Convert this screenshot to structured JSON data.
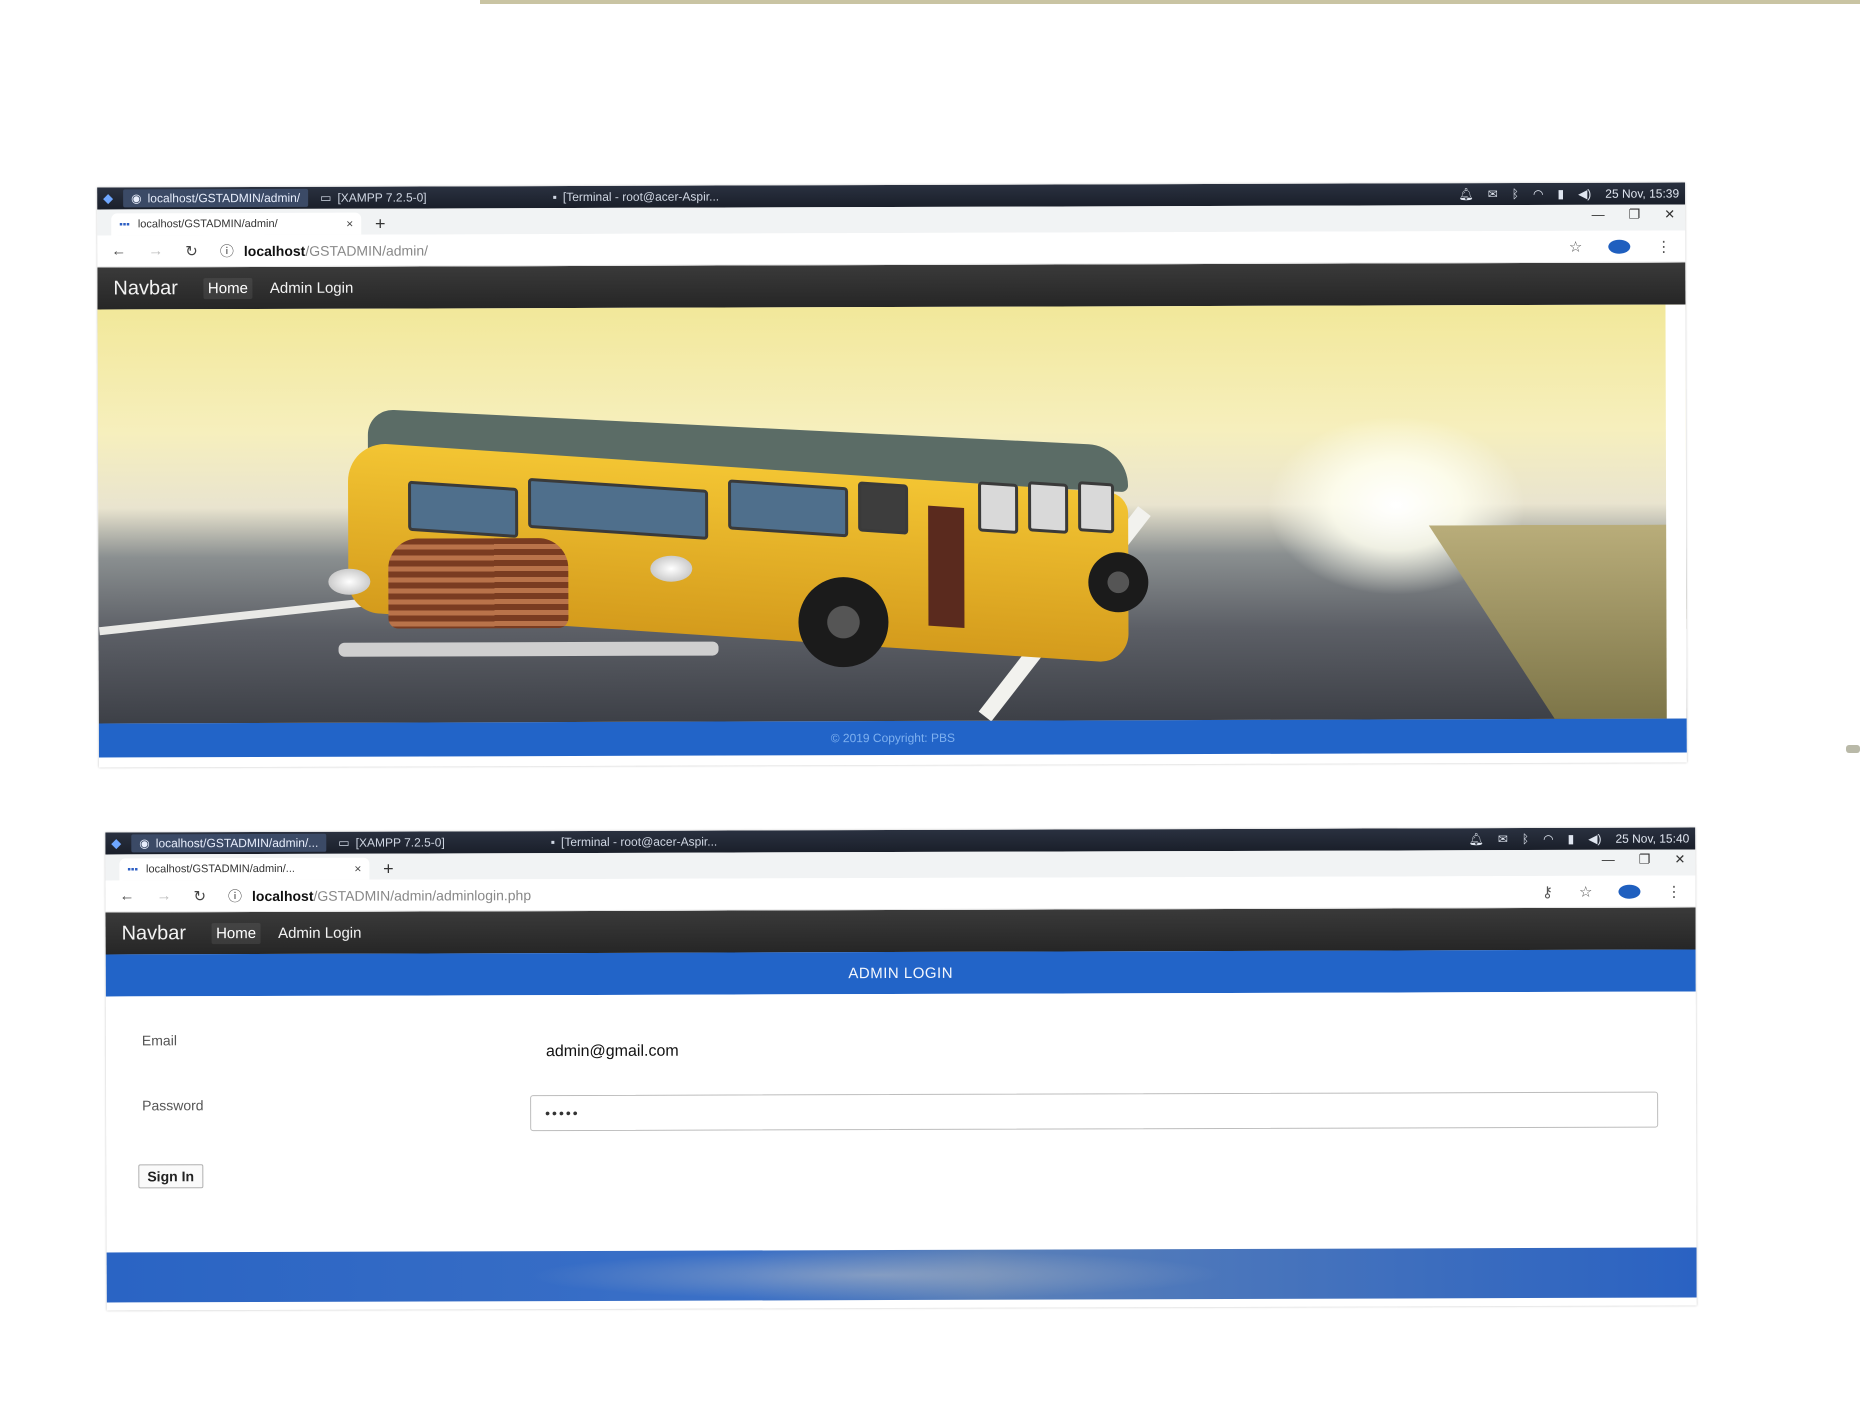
{
  "colors": {
    "navbar_bg": "#2b2b2b",
    "accent_blue": "#2264c8",
    "taskbar_bg": "#1f2430"
  },
  "screenshot1": {
    "taskbar": {
      "tasks": [
        "localhost/GSTADMIN/admin/",
        "[XAMPP 7.2.5-0]",
        "[Terminal - root@acer-Aspir..."
      ],
      "clock": "25 Nov, 15:39"
    },
    "tab": {
      "title": "localhost/GSTADMIN/admin/",
      "close": "×",
      "new_tab": "+"
    },
    "address": {
      "host": "localhost",
      "path": "/GSTADMIN/admin/"
    },
    "navbar": {
      "brand": "Navbar",
      "links": [
        "Home",
        "Admin Login"
      ]
    },
    "footer": {
      "text": "© 2019 Copyright: PBS"
    }
  },
  "screenshot2": {
    "taskbar": {
      "tasks": [
        "localhost/GSTADMIN/admin/...",
        "[XAMPP 7.2.5-0]",
        "[Terminal - root@acer-Aspir..."
      ],
      "clock": "25 Nov, 15:40"
    },
    "tab": {
      "title": "localhost/GSTADMIN/admin/...",
      "close": "×",
      "new_tab": "+"
    },
    "address": {
      "host": "localhost",
      "path": "/GSTADMIN/admin/adminlogin.php"
    },
    "navbar": {
      "brand": "Navbar",
      "links": [
        "Home",
        "Admin Login"
      ]
    },
    "login": {
      "heading": "ADMIN LOGIN",
      "email_label": "Email",
      "email_value": "admin@gmail.com",
      "password_label": "Password",
      "password_value": "•••••",
      "submit_label": "Sign In"
    }
  }
}
